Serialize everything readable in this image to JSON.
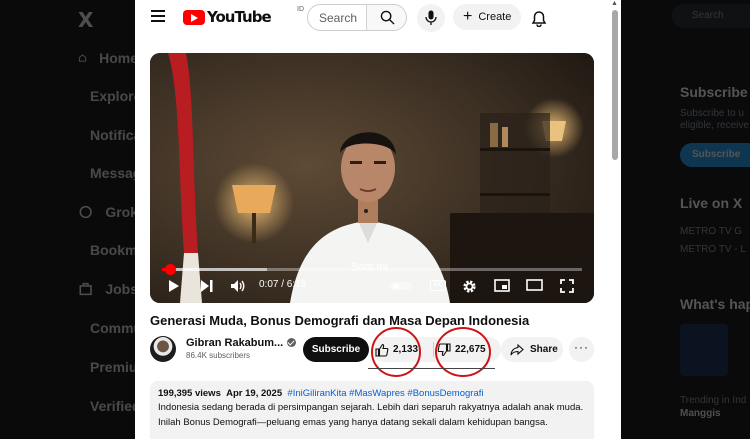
{
  "x_sidebar": {
    "logo": "X",
    "items": [
      {
        "label": "Home",
        "icon": "home-icon"
      },
      {
        "label": "Explore",
        "icon": "search-icon"
      },
      {
        "label": "Notifications",
        "icon": "bell-icon"
      },
      {
        "label": "Messages",
        "icon": "mail-icon"
      },
      {
        "label": "Grok",
        "icon": "grok-icon"
      },
      {
        "label": "Bookmarks",
        "icon": "bookmark-icon"
      },
      {
        "label": "Jobs",
        "icon": "briefcase-icon"
      },
      {
        "label": "Communities",
        "icon": "people-icon"
      },
      {
        "label": "Premium",
        "icon": "x-icon"
      },
      {
        "label": "Verified",
        "icon": "lightning-icon"
      }
    ]
  },
  "x_right": {
    "search_placeholder": "Search",
    "subscribe_heading": "Subscribe",
    "subscribe_text_1": "Subscribe to u",
    "subscribe_text_2": "eligible, receive",
    "subscribe_btn": "Subscribe",
    "live_heading": "Live on X",
    "live_line_1": "METRO TV G",
    "live_line_2": "METRO TV - L",
    "happening_heading": "What's hap",
    "trend_small": "Trending in Ind",
    "trend_name": "Manggis"
  },
  "youtube": {
    "logo_text": "YouTube",
    "country_code": "ID",
    "search_placeholder": "Search",
    "create_label": "Create",
    "player": {
      "tooltip": "Saat ini",
      "time": "0:07 / 6:19",
      "cc_label": "CC",
      "progress_fraction": 0.018
    },
    "title": "Generasi Muda, Bonus Demografi dan Masa Depan Indonesia",
    "channel": {
      "name": "Gibran Rakabum...",
      "subscribers": "86.4K subscribers"
    },
    "subscribe_label": "Subscribe",
    "likes": "2,133",
    "dislikes": "22,675",
    "share_label": "Share",
    "more_label": "···",
    "description": {
      "views": "199,395 views",
      "date": "Apr 19, 2025",
      "hashtags": "#IniGiliranKita #MasWapres #BonusDemografi",
      "line1": "Indonesia sedang berada di persimpangan sejarah. Lebih dari separuh rakyatnya adalah anak muda.",
      "line2": "Inilah Bonus Demografi—peluang emas yang hanya datang sekali dalam kehidupan bangsa."
    }
  },
  "colors": {
    "youtube_red": "#FF0000",
    "annotation_red": "#CC1417",
    "hashtag_blue": "#065FD4"
  }
}
